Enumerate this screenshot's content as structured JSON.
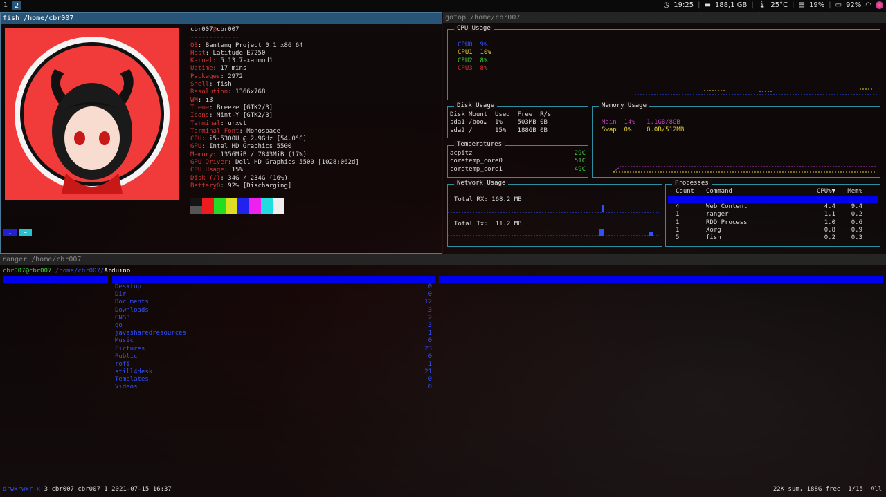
{
  "topbar": {
    "workspaces": [
      "1",
      "2"
    ],
    "clock": "19:25",
    "disk": "188,1 GB",
    "temp": "25°C",
    "cpu": "19%",
    "battery": "92%"
  },
  "fish": {
    "title": "fish /home/cbr007",
    "user": "cbr007",
    "at": "@",
    "host": "cbr007",
    "underline": "-------------",
    "info": [
      {
        "k": "OS",
        "v": "Banteng_Project 0.1 x86_64"
      },
      {
        "k": "Host",
        "v": "Latitude E7250"
      },
      {
        "k": "Kernel",
        "v": "5.13.7-xanmod1"
      },
      {
        "k": "Uptime",
        "v": "17 mins"
      },
      {
        "k": "Packages",
        "v": "2972"
      },
      {
        "k": "Shell",
        "v": "fish"
      },
      {
        "k": "Resolution",
        "v": "1366x768"
      },
      {
        "k": "WM",
        "v": "i3"
      },
      {
        "k": "Theme",
        "v": "Breeze [GTK2/3]"
      },
      {
        "k": "Icons",
        "v": "Mint-Y [GTK2/3]"
      },
      {
        "k": "Terminal",
        "v": "urxvt"
      },
      {
        "k": "Terminal Font",
        "v": "Monospace"
      },
      {
        "k": "CPU",
        "v": "i5-5300U @ 2.9GHz [54.0°C]"
      },
      {
        "k": "GPU",
        "v": "Intel HD Graphics 5500"
      },
      {
        "k": "Memory",
        "v": "1356MiB / 7843MiB (17%)"
      },
      {
        "k": "GPU Driver",
        "v": "Dell HD Graphics 5500 [1028:062d]"
      },
      {
        "k": "CPU Usage",
        "v": "15%"
      },
      {
        "k": "Disk (/)",
        "v": "34G / 234G (16%)"
      },
      {
        "k": "Battery0",
        "v": "92% [Discharging]"
      }
    ],
    "swatch_colors_top": [
      "#141414",
      "#ee1c1c",
      "#22dd22",
      "#dddd22",
      "#2222ee",
      "#ee22ee",
      "#22dddd",
      "#eeeeee"
    ],
    "swatch_colors_bottom": [
      "#555555",
      "#ee1c1c",
      "#22dd22",
      "#dddd22",
      "#2222ee",
      "#ee22ee",
      "#22dddd",
      "#eeeeee"
    ],
    "prompt": [
      "↓",
      "~"
    ]
  },
  "gotop": {
    "title": "gotop /home/cbr007",
    "cpu": {
      "title": "CPU Usage",
      "rows": [
        {
          "label": "CPU0",
          "val": "9%",
          "color": "#3050ff"
        },
        {
          "label": "CPU1",
          "val": "10%",
          "color": "#e0d030"
        },
        {
          "label": "CPU2",
          "val": "8%",
          "color": "#3ecf3e"
        },
        {
          "label": "CPU3",
          "val": "8%",
          "color": "#d43333"
        }
      ]
    },
    "disk": {
      "title": "Disk Usage",
      "headers": [
        "Disk",
        "Mount",
        "Used",
        "Free",
        "R/s"
      ],
      "rows": [
        [
          "sda1",
          "/boo…",
          "1%",
          "503MB",
          "0B"
        ],
        [
          "sda2",
          "/",
          "15%",
          "188GB",
          "0B"
        ]
      ]
    },
    "memory": {
      "title": "Memory Usage",
      "main_label": "Main",
      "main_pct": "14%",
      "main_val": "1.1GB/8GB",
      "swap_label": "Swap",
      "swap_pct": "0%",
      "swap_val": "0.0B/512MB"
    },
    "temps": {
      "title": "Temperatures",
      "rows": [
        {
          "name": "acpitz",
          "val": "29C"
        },
        {
          "name": "coretemp_core0",
          "val": "51C"
        },
        {
          "name": "coretemp_core1",
          "val": "49C"
        }
      ]
    },
    "network": {
      "title": "Network Usage",
      "rx": "Total RX: 168.2 MB",
      "tx": "Total Tx:  11.2 MB"
    },
    "processes": {
      "title": "Processes",
      "headers": [
        "Count",
        "Command",
        "CPU%▼",
        "Mem%"
      ],
      "rows": [
        [
          "4",
          "Web Content",
          "4.4",
          "9.4"
        ],
        [
          "1",
          "ranger",
          "1.1",
          "0.2"
        ],
        [
          "1",
          "RDD Process",
          "1.0",
          "0.6"
        ],
        [
          "1",
          "Xorg",
          "0.8",
          "0.9"
        ],
        [
          "5",
          "fish",
          "0.2",
          "0.3"
        ]
      ]
    }
  },
  "ranger": {
    "title": "ranger /home/cbr007",
    "crumb_user": "cbr007@cbr007",
    "crumb_path": " /home/cbr007/",
    "crumb_sel": "Arduino",
    "dirs": [
      {
        "name": "Desktop",
        "count": "0"
      },
      {
        "name": "Dir",
        "count": "0"
      },
      {
        "name": "Documents",
        "count": "12"
      },
      {
        "name": "Downloads",
        "count": "3"
      },
      {
        "name": "GNS3",
        "count": "2"
      },
      {
        "name": "go",
        "count": "3"
      },
      {
        "name": "javasharedresources",
        "count": "1"
      },
      {
        "name": "Music",
        "count": "0"
      },
      {
        "name": "Pictures",
        "count": "23"
      },
      {
        "name": "Public",
        "count": "0"
      },
      {
        "name": "rofi",
        "count": "1"
      },
      {
        "name": "still4desk",
        "count": "21"
      },
      {
        "name": "Templates",
        "count": "0"
      },
      {
        "name": "Videos",
        "count": "0"
      }
    ],
    "status_left": "drwxrwxr-x 3 cbr007 cbr007 1 2021-07-15 16:37",
    "status_right": "22K sum, 188G free  1/15  All"
  }
}
